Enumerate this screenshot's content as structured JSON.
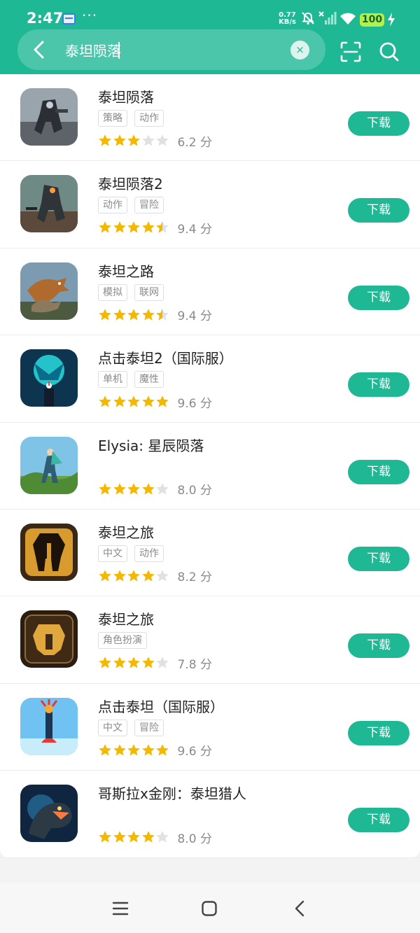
{
  "status_bar": {
    "time": "2:47",
    "more": "···",
    "net_speed_value": "0.77",
    "net_speed_unit": "KB/s",
    "battery": "100"
  },
  "search": {
    "query": "泰坦陨落",
    "clear": "×"
  },
  "colors": {
    "accent": "#1fb895",
    "star_filled": "#f5b800",
    "star_empty": "#e1e1e1"
  },
  "icons": [
    "chevron-left-icon",
    "close-icon",
    "scan-icon",
    "search-icon",
    "menu-icon",
    "home-icon",
    "back-icon",
    "star-icon"
  ],
  "apps": [
    {
      "name": "泰坦陨落",
      "tags": [
        "策略",
        "动作"
      ],
      "rating": 3,
      "score": "6.2 分",
      "button": "下载"
    },
    {
      "name": "泰坦陨落2",
      "tags": [
        "动作",
        "冒险"
      ],
      "rating": 4.5,
      "score": "9.4 分",
      "button": "下载"
    },
    {
      "name": "泰坦之路",
      "tags": [
        "模拟",
        "联网"
      ],
      "rating": 4.5,
      "score": "9.4 分",
      "button": "下载"
    },
    {
      "name": "点击泰坦2（国际服）",
      "tags": [
        "单机",
        "魔性"
      ],
      "rating": 5,
      "score": "9.6 分",
      "button": "下载"
    },
    {
      "name": "Elysia: 星辰陨落",
      "tags": [],
      "rating": 4,
      "score": "8.0 分",
      "button": "下载"
    },
    {
      "name": "泰坦之旅",
      "tags": [
        "中文",
        "动作"
      ],
      "rating": 4,
      "score": "8.2 分",
      "button": "下载"
    },
    {
      "name": "泰坦之旅",
      "tags": [
        "角色扮演"
      ],
      "rating": 4,
      "score": "7.8 分",
      "button": "下载"
    },
    {
      "name": "点击泰坦（国际服）",
      "tags": [
        "中文",
        "冒险"
      ],
      "rating": 5,
      "score": "9.6 分",
      "button": "下载"
    },
    {
      "name": "哥斯拉x金刚：泰坦猎人",
      "tags": [],
      "rating": 4,
      "score": "8.0 分",
      "button": "下载"
    }
  ]
}
